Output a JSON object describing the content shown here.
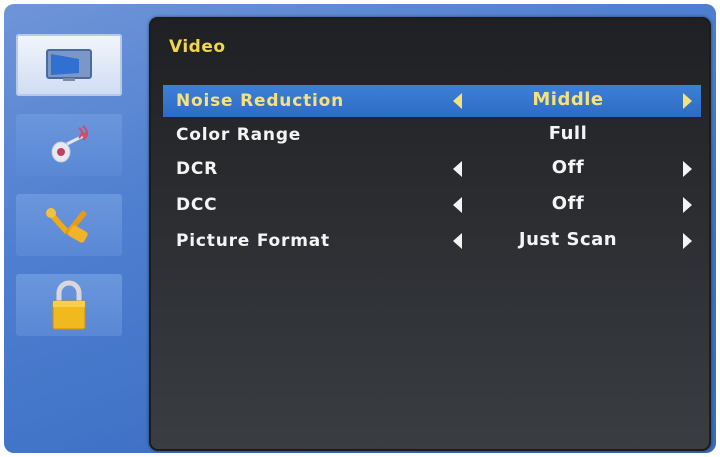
{
  "sidebar": {
    "items": [
      {
        "icon": "picture-icon",
        "active": true
      },
      {
        "icon": "audio-icon",
        "active": false
      },
      {
        "icon": "tools-icon",
        "active": false
      },
      {
        "icon": "lock-icon",
        "active": false
      }
    ]
  },
  "menu": {
    "title": "Video",
    "rows": [
      {
        "label": "Noise Reduction",
        "value": "Middle",
        "selected": true,
        "arrows": true
      },
      {
        "label": "Color Range",
        "value": "Full",
        "selected": false,
        "arrows": false
      },
      {
        "label": "DCR",
        "value": "Off",
        "selected": false,
        "arrows": true
      },
      {
        "label": "DCC",
        "value": "Off",
        "selected": false,
        "arrows": true
      },
      {
        "label": "Picture Format",
        "value": "Just Scan",
        "selected": false,
        "arrows": true
      }
    ]
  },
  "colors": {
    "title": "#f2d64a",
    "highlight": "#2e6cc4",
    "selected_text": "#f6e27a",
    "text": "#f4f4f4"
  }
}
